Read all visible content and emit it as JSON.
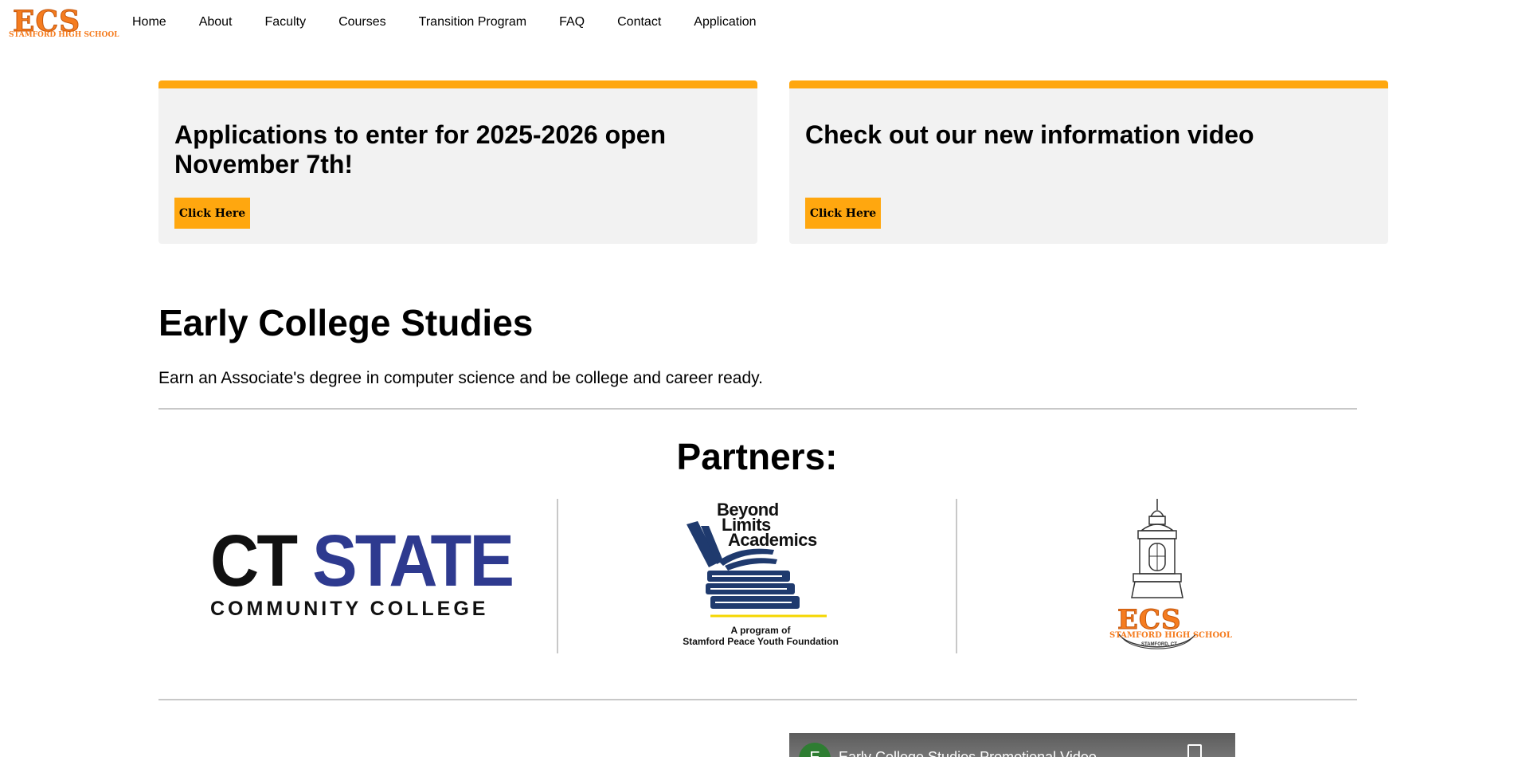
{
  "nav": {
    "logo_text": "ECS",
    "logo_subtext": "STAMFORD HIGH SCHOOL",
    "links": [
      "Home",
      "About",
      "Faculty",
      "Courses",
      "Transition Program",
      "FAQ",
      "Contact",
      "Application"
    ]
  },
  "cards": [
    {
      "title": "Applications to enter for 2025-2026 open November 7th!",
      "button": "Click Here"
    },
    {
      "title": "Check out our new information video",
      "button": "Click Here"
    }
  ],
  "main": {
    "title": "Early College Studies",
    "subtitle": "Earn an Associate's degree in computer science and be college and career ready."
  },
  "partners": {
    "title": "Partners:",
    "ct_state": {
      "line1_a": "CT ",
      "line1_b": "STATE",
      "line2": "COMMUNITY COLLEGE"
    },
    "beyond_limits": {
      "line1": "Beyond",
      "line2": "Limits",
      "line3": "Academics",
      "caption1": "A program of",
      "caption2": "Stamford Peace Youth Foundation"
    },
    "ecs": {
      "text": "ECS",
      "subtext": "STAMFORD HIGH SCHOOL",
      "place": "STAMFORD, CT"
    }
  },
  "video": {
    "avatar": "E",
    "title": "Early College Studies Promotional Video"
  },
  "colors": {
    "accent": "#ffa70f",
    "logo_orange": "#f57c1f",
    "card_bg": "#f2f2f2",
    "ct_blue": "#2e3a8f",
    "bl_blue": "#1f3a6e"
  }
}
